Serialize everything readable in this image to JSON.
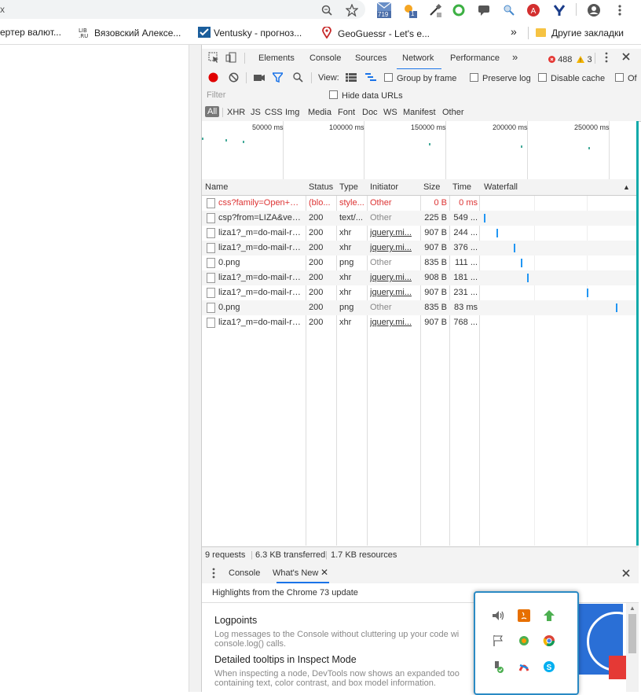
{
  "browser": {
    "omnibox_text": "x",
    "toolbar_icons": [
      "zoom-icon",
      "star-icon",
      "mail-extension-icon",
      "weather-extension-icon",
      "eyedropper-extension-icon",
      "circle-extension-icon",
      "chat-extension-icon",
      "search-extension-icon",
      "adblock-extension-icon",
      "vpn-extension-icon",
      "profile-icon",
      "menu-icon"
    ],
    "mail_badge": "719",
    "weather_badge": "1",
    "bookmarks": [
      {
        "label": "ертер валют..."
      },
      {
        "label": "Вязовский Алексе..."
      },
      {
        "label": "Ventusky - прогноз..."
      },
      {
        "label": "GeoGuessr - Let's e..."
      }
    ],
    "bookmarks_overflow": "»",
    "other_bookmarks": "Другие закладки"
  },
  "devtools": {
    "tabs": [
      "Elements",
      "Console",
      "Sources",
      "Network",
      "Performance"
    ],
    "active_tab": "Network",
    "more_tabs": "»",
    "errors_count": "488",
    "warnings_count": "3",
    "toolbar": {
      "view_label": "View:",
      "group_by_frame": "Group by frame",
      "preserve_log": "Preserve log",
      "disable_cache": "Disable cache",
      "offline_cut": "Of"
    },
    "filter": {
      "placeholder": "Filter",
      "hide_data_urls": "Hide data URLs"
    },
    "types": [
      "All",
      "XHR",
      "JS",
      "CSS",
      "Img",
      "Media",
      "Font",
      "Doc",
      "WS",
      "Manifest",
      "Other"
    ],
    "overview_labels": [
      "50000 ms",
      "100000 ms",
      "150000 ms",
      "200000 ms",
      "250000 ms"
    ],
    "columns": [
      "Name",
      "Status",
      "Type",
      "Initiator",
      "Size",
      "Time",
      "Waterfall"
    ],
    "rows": [
      {
        "name": "css?family=Open+Sa...",
        "status": "(blo...",
        "type": "style...",
        "initiator": "Other",
        "size": "0 B",
        "time": "0 ms",
        "error": true
      },
      {
        "name": "csp?from=LIZA&vers...",
        "status": "200",
        "type": "text/...",
        "initiator": "Other",
        "size": "225 B",
        "time": "549 ..."
      },
      {
        "name": "liza1?_m=do-mail-re...",
        "status": "200",
        "type": "xhr",
        "initiator": "jquery.mi...",
        "size": "907 B",
        "time": "244 ..."
      },
      {
        "name": "liza1?_m=do-mail-re...",
        "status": "200",
        "type": "xhr",
        "initiator": "jquery.mi...",
        "size": "907 B",
        "time": "376 ..."
      },
      {
        "name": "0.png",
        "status": "200",
        "type": "png",
        "initiator": "Other",
        "size": "835 B",
        "time": "111 ..."
      },
      {
        "name": "liza1?_m=do-mail-re...",
        "status": "200",
        "type": "xhr",
        "initiator": "jquery.mi...",
        "size": "908 B",
        "time": "181 ..."
      },
      {
        "name": "liza1?_m=do-mail-re...",
        "status": "200",
        "type": "xhr",
        "initiator": "jquery.mi...",
        "size": "907 B",
        "time": "231 ..."
      },
      {
        "name": "0.png",
        "status": "200",
        "type": "png",
        "initiator": "Other",
        "size": "835 B",
        "time": "83 ms"
      },
      {
        "name": "liza1?_m=do-mail-re...",
        "status": "200",
        "type": "xhr",
        "initiator": "jquery.mi...",
        "size": "907 B",
        "time": "768 ..."
      }
    ],
    "status": {
      "requests": "9 requests",
      "transferred": "6.3 KB transferred",
      "resources": "1.7 KB resources"
    },
    "drawer": {
      "tabs": [
        "Console",
        "What's New"
      ],
      "active_tab": "What's New",
      "highlights": "Highlights from the Chrome 73 update",
      "items": [
        {
          "title": "Logpoints",
          "desc": "Log messages to the Console without cluttering up your code wi console.log() calls."
        },
        {
          "title": "Detailed tooltips in Inspect Mode",
          "desc": "When inspecting a node, DevTools now shows an expanded too containing text, color contrast, and box model information."
        }
      ]
    }
  },
  "tray": {
    "icons": [
      "speaker-icon",
      "java-icon",
      "update-arrow-icon",
      "flag-icon",
      "tray-app-icon",
      "chrome-icon",
      "usb-safe-remove-icon",
      "utility-icon",
      "skype-icon"
    ]
  },
  "colors": {
    "accent": "#1a73e8",
    "error": "#d33333",
    "record": "#e00000",
    "tray_border": "#2a8ac4",
    "waterfall": "#2196f3"
  }
}
